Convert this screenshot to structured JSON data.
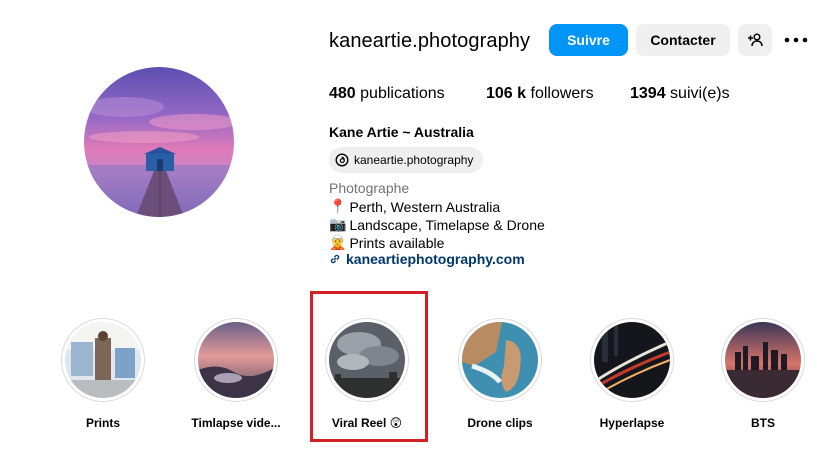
{
  "profile": {
    "username": "kaneartie.photography",
    "follow_label": "Suivre",
    "contact_label": "Contacter",
    "stats": {
      "posts_count": "480",
      "posts_label": "publications",
      "followers_count": "106 k",
      "followers_label": "followers",
      "following_count": "1394",
      "following_label": "suivi(e)s"
    },
    "full_name": "Kane Artie ~ Australia",
    "threads_handle": "kaneartie.photography",
    "category": "Photographe",
    "bio": [
      {
        "emoji": "📍",
        "text": "Perth, Western Australia"
      },
      {
        "emoji": "📷",
        "text": "Landscape, Timelapse & Drone"
      },
      {
        "emoji": "🧝",
        "text": "Prints available"
      }
    ],
    "link": "kaneartiephotography.com"
  },
  "highlights": [
    {
      "label": "Prints"
    },
    {
      "label": "Timlapse vide..."
    },
    {
      "label": "Viral Reel 😲"
    },
    {
      "label": "Drone clips"
    },
    {
      "label": "Hyperlapse"
    },
    {
      "label": "BTS"
    }
  ],
  "colors": {
    "accent": "#0095f6",
    "secondary_button": "#efefef",
    "link": "#00376b",
    "highlight_box": "#d32027"
  }
}
